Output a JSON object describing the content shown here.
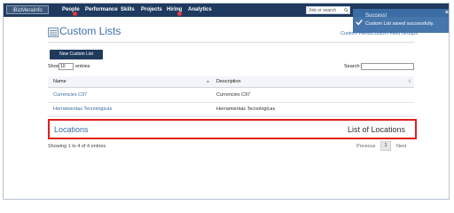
{
  "nav": {
    "logo": "iBizMeraInfo",
    "items": [
      "People",
      "Performance",
      "Skills",
      "Projects",
      "Hiring",
      "Analytics"
    ],
    "search_placeholder": "Jink or search",
    "badge_color": "#e2393b",
    "bar_color": "#1f3a5f"
  },
  "toast": {
    "title": "Success!",
    "message": "Custom List saved successfully.",
    "close": "×",
    "color": "#3d6fa8"
  },
  "header": {
    "title": "Custom Lists",
    "links": [
      "Custom Fields",
      "Custom Field Groups"
    ]
  },
  "toolbar": {
    "new_button": "New Custom List",
    "show_label": "Show",
    "show_value": "10",
    "entries_label": "entries",
    "search_label": "Search:"
  },
  "table": {
    "columns": [
      "Name",
      "Description"
    ],
    "rows": [
      {
        "name": "Currencies C97",
        "description": "Currencies C97"
      },
      {
        "name": "Herramientas Tecnológicas",
        "description": "Herramientas Tecnológicas"
      }
    ],
    "highlighted_row": {
      "name": "Locations",
      "description": "List of Locations"
    }
  },
  "footer": {
    "showing": "Showing 1 to 4 of 4 entries",
    "previous": "Previous",
    "page": "1",
    "next": "Next"
  }
}
